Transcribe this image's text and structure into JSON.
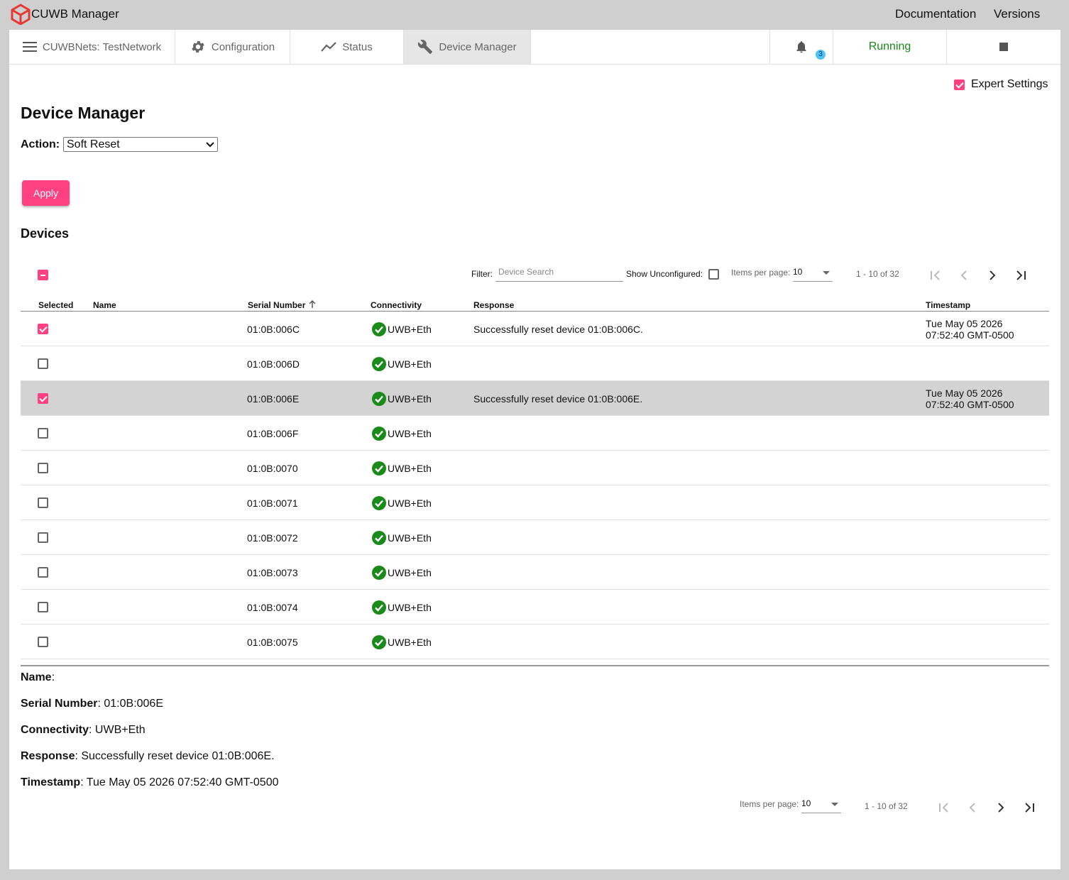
{
  "app": {
    "title": "CUWB Manager",
    "links": [
      "Documentation",
      "Versions"
    ]
  },
  "nav": {
    "network": "CUWBNets: TestNetwork",
    "tabs": [
      "Configuration",
      "Status",
      "Device Manager"
    ],
    "active_tab": "Device Manager",
    "notification_count": "3",
    "status": "Running",
    "status_color": "#1a8a1a"
  },
  "expert_settings": {
    "label": "Expert Settings",
    "checked": true
  },
  "page": {
    "title": "Device Manager",
    "action_label": "Action:",
    "action_value": "Soft Reset",
    "apply_label": "Apply",
    "devices_heading": "Devices"
  },
  "toolbar": {
    "filter_label": "Filter:",
    "filter_placeholder": "Device Search",
    "show_unconfigured_label": "Show Unconfigured:",
    "items_per_page_label": "Items per page:",
    "items_per_page_value": "10",
    "range_label": "1 - 10 of 32"
  },
  "table": {
    "columns": [
      "Selected",
      "Name",
      "Serial Number",
      "Connectivity",
      "Response",
      "Timestamp"
    ],
    "rows": [
      {
        "selected": true,
        "name": "",
        "serial": "01:0B:006C",
        "connectivity": "UWB+Eth",
        "response": "Successfully reset device 01:0B:006C.",
        "ts1": "Tue May 05 2026",
        "ts2": "07:52:40 GMT-0500"
      },
      {
        "selected": false,
        "name": "",
        "serial": "01:0B:006D",
        "connectivity": "UWB+Eth",
        "response": "",
        "ts1": "",
        "ts2": ""
      },
      {
        "selected": true,
        "name": "",
        "serial": "01:0B:006E",
        "connectivity": "UWB+Eth",
        "response": "Successfully reset device 01:0B:006E.",
        "ts1": "Tue May 05 2026",
        "ts2": "07:52:40 GMT-0500"
      },
      {
        "selected": false,
        "name": "",
        "serial": "01:0B:006F",
        "connectivity": "UWB+Eth",
        "response": "",
        "ts1": "",
        "ts2": ""
      },
      {
        "selected": false,
        "name": "",
        "serial": "01:0B:0070",
        "connectivity": "UWB+Eth",
        "response": "",
        "ts1": "",
        "ts2": ""
      },
      {
        "selected": false,
        "name": "",
        "serial": "01:0B:0071",
        "connectivity": "UWB+Eth",
        "response": "",
        "ts1": "",
        "ts2": ""
      },
      {
        "selected": false,
        "name": "",
        "serial": "01:0B:0072",
        "connectivity": "UWB+Eth",
        "response": "",
        "ts1": "",
        "ts2": ""
      },
      {
        "selected": false,
        "name": "",
        "serial": "01:0B:0073",
        "connectivity": "UWB+Eth",
        "response": "",
        "ts1": "",
        "ts2": ""
      },
      {
        "selected": false,
        "name": "",
        "serial": "01:0B:0074",
        "connectivity": "UWB+Eth",
        "response": "",
        "ts1": "",
        "ts2": ""
      },
      {
        "selected": false,
        "name": "",
        "serial": "01:0B:0075",
        "connectivity": "UWB+Eth",
        "response": "",
        "ts1": "",
        "ts2": ""
      }
    ]
  },
  "details": {
    "name_label": "Name",
    "name_value": "",
    "serial_label": "Serial Number",
    "serial_value": "01:0B:006E",
    "connectivity_label": "Connectivity",
    "connectivity_value": "UWB+Eth",
    "response_label": "Response",
    "response_value": "Successfully reset device 01:0B:006E.",
    "timestamp_label": "Timestamp",
    "timestamp_value": "Tue May 05 2026 07:52:40 GMT-0500"
  },
  "colors": {
    "accent": "#ff4081",
    "ok": "#1a8a1a",
    "highlight_row": "#d3d3d3"
  }
}
